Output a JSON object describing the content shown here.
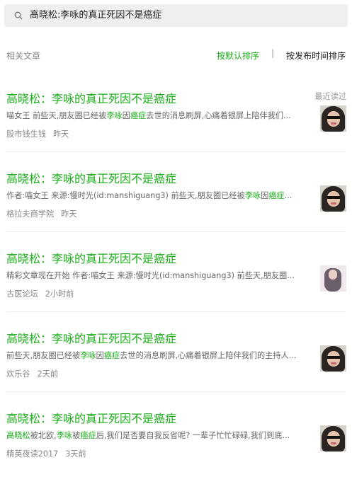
{
  "search": {
    "query": "高晓松:李咏的真正死因不是癌症"
  },
  "header": {
    "label": "相关文章",
    "sort_default": "按默认排序",
    "separator": "|",
    "sort_time": "按发布时间排序"
  },
  "colors": {
    "accent": "#1aad19",
    "search_bg": "#efeff1"
  },
  "results": [
    {
      "title": "高晓松：李咏的真正死因不是癌症",
      "tag": "最近读过",
      "desc_parts": [
        "喵女王 前些天,朋友圈已经被",
        "李咏",
        "因",
        "癌症",
        "去世的消息刷屏,心痛着银屏上陪伴我们..."
      ],
      "source": "股市钱生钱",
      "time": "昨天",
      "thumb_icon": "portrait-thumbnail"
    },
    {
      "title": "高晓松：李咏的真正死因不是癌症",
      "desc_parts": [
        "作者:喵女王 来源:慢时光(id:manshiguang3) 前些天,朋友圈已经被",
        "李咏",
        "因",
        "癌症",
        "..."
      ],
      "source": "格拉夫商学院",
      "time": "昨天",
      "thumb_icon": "portrait-thumbnail"
    },
    {
      "title": "高晓松：李咏的真正死因不是癌症",
      "desc_parts": [
        "精彩文章现在开始 作者:喵女王 来源:慢时光(id:manshiguang3) 前些天,朋友圈...",
        "",
        "",
        "",
        ""
      ],
      "source": "古医论坛",
      "time": "2小时前",
      "thumb_icon": "portrait-thumbnail"
    },
    {
      "title": "高晓松：李咏的真正死因不是癌症",
      "desc_parts": [
        "前些天,朋友圈已经被",
        "李咏",
        "因",
        "癌症",
        "去世的消息刷屏,心痛着银屏上陪伴我们的主持人..."
      ],
      "source": "欢乐谷",
      "time": "2天前",
      "thumb_icon": "portrait-thumbnail"
    },
    {
      "title": "高晓松：李咏的真正死因不是癌症",
      "desc_parts": [
        "高晓松",
        "被北欧,",
        "李咏",
        "被",
        "癌症",
        "后,我们是否要自我反省呢? 一辈子忙忙碌碌,我们到底..."
      ],
      "source": "精英夜读2017",
      "time": "3天前",
      "thumb_icon": "portrait-thumbnail"
    }
  ]
}
